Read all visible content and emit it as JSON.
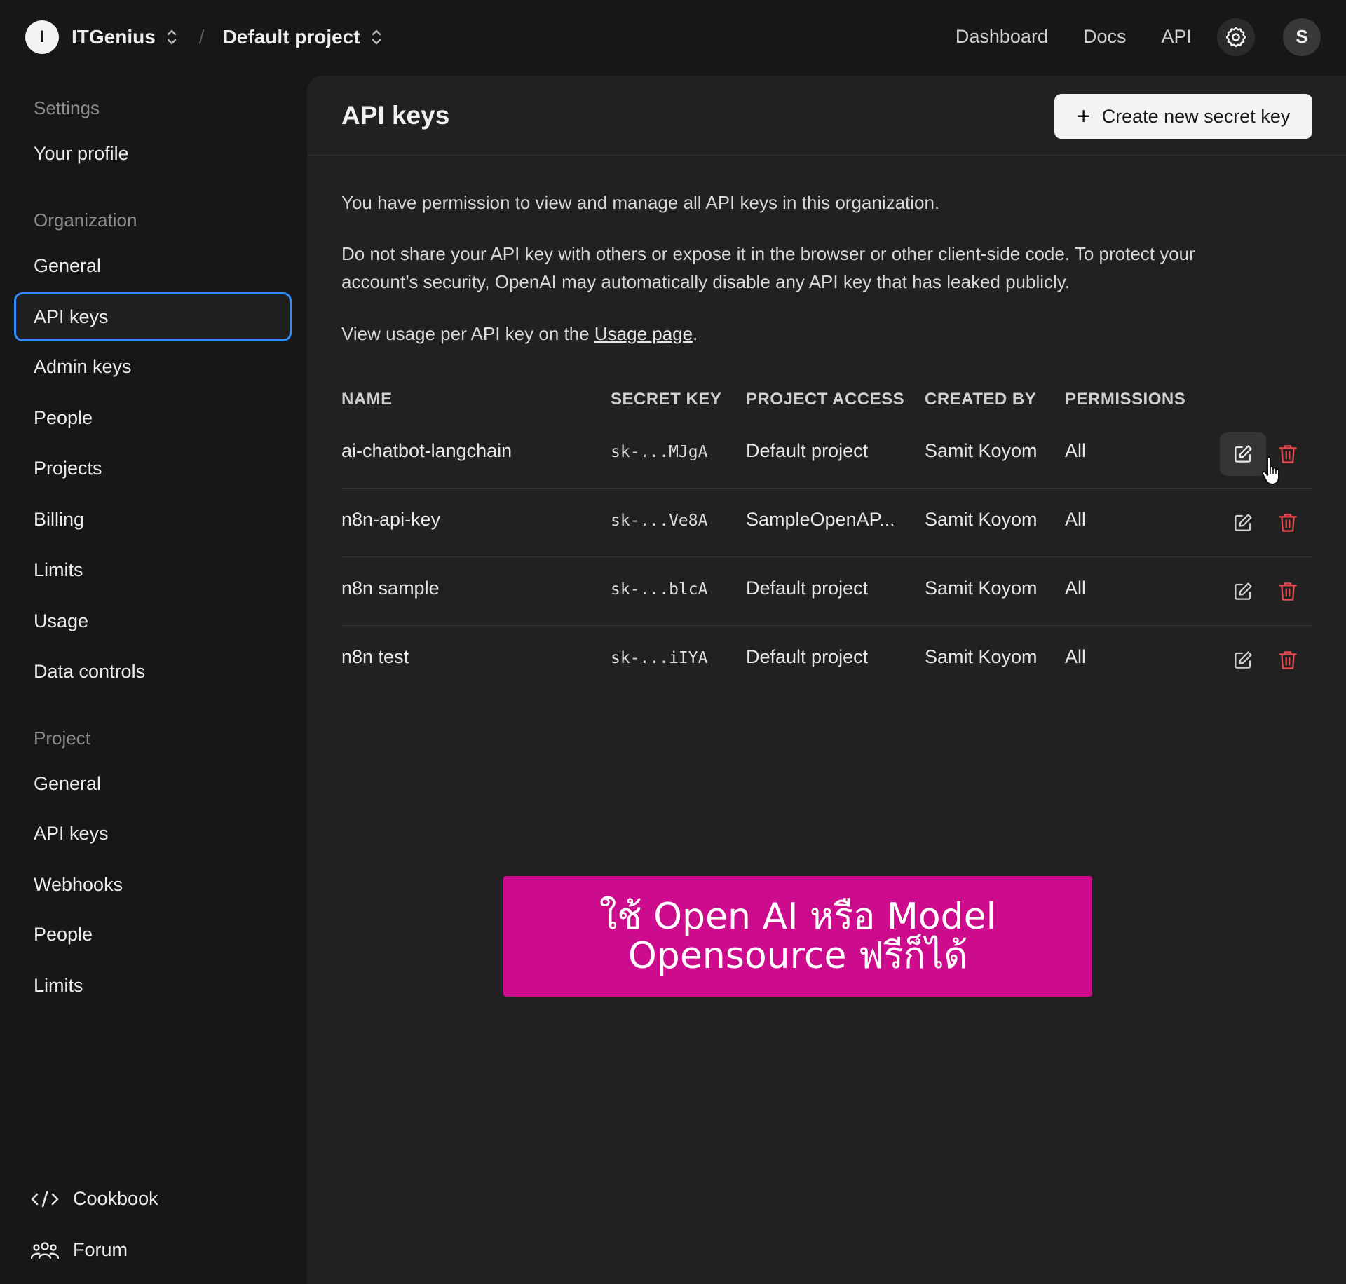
{
  "topbar": {
    "org_initial": "I",
    "org_name": "ITGenius",
    "separator": "/",
    "project_name": "Default project",
    "nav": [
      "Dashboard",
      "Docs",
      "API"
    ],
    "user_initial": "S"
  },
  "sidebar": {
    "settings_label": "Settings",
    "your_profile": "Your profile",
    "organization_label": "Organization",
    "organization_items": [
      "General",
      "API keys",
      "Admin keys",
      "People",
      "Projects",
      "Billing",
      "Limits",
      "Usage",
      "Data controls"
    ],
    "project_label": "Project",
    "project_items": [
      "General",
      "API keys",
      "Webhooks",
      "People",
      "Limits"
    ],
    "footer": {
      "cookbook": "Cookbook",
      "forum": "Forum"
    }
  },
  "main": {
    "title": "API keys",
    "create_button": "Create new secret key",
    "permission_text": "You have permission to view and manage all API keys in this organization.",
    "warning_line1": "Do not share your API key with others or expose it in the browser or other client-side code. To protect your",
    "warning_line2": "account’s security, OpenAI may automatically disable any API key that has leaked publicly.",
    "usage_prefix": "View usage per API key on the ",
    "usage_link": "Usage page",
    "usage_suffix": ".",
    "columns": [
      "NAME",
      "SECRET KEY",
      "PROJECT ACCESS",
      "CREATED BY",
      "PERMISSIONS"
    ],
    "rows": [
      {
        "name": "ai-chatbot-langchain",
        "secret": "sk-...MJgA",
        "project": "Default project",
        "created_by": "Samit Koyom",
        "permissions": "All"
      },
      {
        "name": "n8n-api-key",
        "secret": "sk-...Ve8A",
        "project": "SampleOpenAP...",
        "created_by": "Samit Koyom",
        "permissions": "All"
      },
      {
        "name": "n8n sample",
        "secret": "sk-...blcA",
        "project": "Default project",
        "created_by": "Samit Koyom",
        "permissions": "All"
      },
      {
        "name": "n8n test",
        "secret": "sk-...iIYA",
        "project": "Default project",
        "created_by": "Samit Koyom",
        "permissions": "All"
      }
    ]
  },
  "banner": {
    "line1": "ใช้ Open AI หรือ Model",
    "line2": "Opensource ฟรีก็ได้"
  },
  "colors": {
    "active_border": "#2f8cff",
    "delete_red": "#e5484d",
    "banner_bg": "#cc0c8c"
  }
}
